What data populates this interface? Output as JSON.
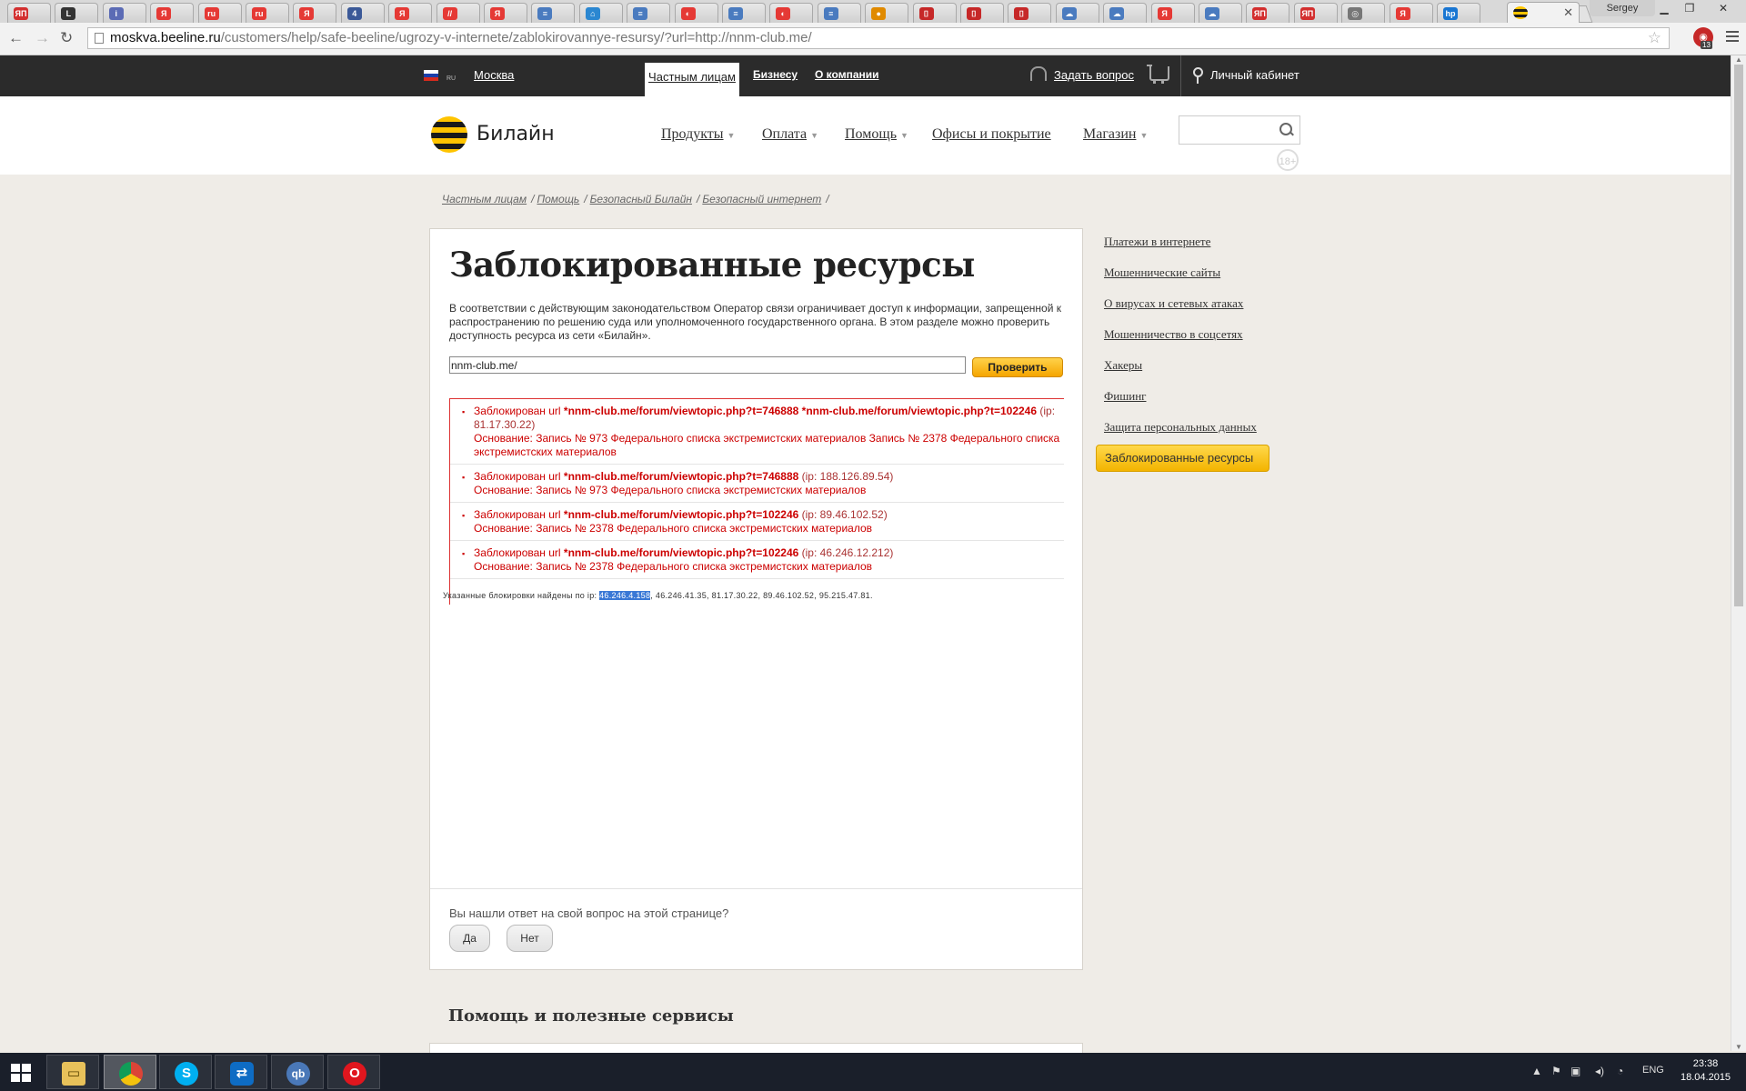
{
  "browser": {
    "tab_favicons": [
      {
        "text": "ЯП",
        "color": "#d32f2f"
      },
      {
        "text": "L",
        "color": "#333333"
      },
      {
        "text": "i",
        "color": "#5b6bb5"
      },
      {
        "text": "Я",
        "color": "#e53935"
      },
      {
        "text": "ru",
        "color": "#e53935"
      },
      {
        "text": "ru",
        "color": "#e53935"
      },
      {
        "text": "Я",
        "color": "#e53935"
      },
      {
        "text": "4",
        "color": "#3b5998"
      },
      {
        "text": "Я",
        "color": "#e53935"
      },
      {
        "text": "//",
        "color": "#e53935"
      },
      {
        "text": "Я",
        "color": "#e53935"
      },
      {
        "text": "≡",
        "color": "#4a7bbf"
      },
      {
        "text": "⌂",
        "color": "#2b87d1"
      },
      {
        "text": "≡",
        "color": "#4a7bbf"
      },
      {
        "text": "◐",
        "color": "#e53935"
      },
      {
        "text": "≡",
        "color": "#4a7bbf"
      },
      {
        "text": "◐",
        "color": "#e53935"
      },
      {
        "text": "≡",
        "color": "#4a7bbf"
      },
      {
        "text": "●",
        "color": "#e08a00"
      },
      {
        "text": "⌷",
        "color": "#c62828"
      },
      {
        "text": "⌷",
        "color": "#c62828"
      },
      {
        "text": "⌷",
        "color": "#c62828"
      },
      {
        "text": "☁",
        "color": "#4a7bbf"
      },
      {
        "text": "☁",
        "color": "#4a7bbf"
      },
      {
        "text": "Я",
        "color": "#e53935"
      },
      {
        "text": "☁",
        "color": "#4a7bbf"
      },
      {
        "text": "ЯП",
        "color": "#d32f2f"
      },
      {
        "text": "ЯП",
        "color": "#d32f2f"
      },
      {
        "text": "◎",
        "color": "#777777"
      },
      {
        "text": "Я",
        "color": "#e53935"
      },
      {
        "text": "hp",
        "color": "#1976d2"
      }
    ],
    "user_name": "Sergey",
    "url_host": "moskva.beeline.ru",
    "url_path": "/customers/help/safe-beeline/ugrozy-v-internete/zablokirovannye-resursy/?url=http://nnm-club.me/",
    "extension_badge": "13"
  },
  "topbar": {
    "city": "Москва",
    "flag_label": "RU",
    "segments": [
      "Частным лицам",
      "Бизнесу",
      "О компании"
    ],
    "ask_question": "Задать вопрос",
    "account": "Личный кабинет"
  },
  "header": {
    "logo_text": "Билайн",
    "nav": [
      "Продукты",
      "Оплата",
      "Помощь",
      "Офисы и покрытие",
      "Магазин"
    ],
    "age_badge": "18+"
  },
  "breadcrumbs": [
    "Частным лицам",
    "Помощь",
    "Безопасный Билайн",
    "Безопасный интернет"
  ],
  "main": {
    "title": "Заблокированные ресурсы",
    "intro": "В соответствии с действующим законодательством Оператор связи ограничивает доступ к информации, запрещенной к распространению по решению суда или уполномоченного государственного органа. В этом разделе можно проверить доступность ресурса из сети «Билайн».",
    "search_value": "nnm-club.me/",
    "check_button": "Проверить",
    "results": [
      {
        "prefix": "Заблокирован url ",
        "url": "*nnm-club.me/forum/viewtopic.php?t=746888 *nnm-club.me/forum/viewtopic.php?t=102246",
        "ip": " (ip: 81.17.30.22)",
        "reason": "Основание: Запись № 973 Федерального списка экстремистских материалов Запись № 2378 Федерального списка экстремистских материалов"
      },
      {
        "prefix": "Заблокирован url ",
        "url": "*nnm-club.me/forum/viewtopic.php?t=746888",
        "ip": " (ip: 188.126.89.54)",
        "reason": "Основание: Запись № 973 Федерального списка экстремистских материалов"
      },
      {
        "prefix": "Заблокирован url ",
        "url": "*nnm-club.me/forum/viewtopic.php?t=102246",
        "ip": " (ip: 89.46.102.52)",
        "reason": "Основание: Запись № 2378 Федерального списка экстремистских материалов"
      },
      {
        "prefix": "Заблокирован url ",
        "url": "*nnm-club.me/forum/viewtopic.php?t=102246",
        "ip": " (ip: 46.246.12.212)",
        "reason": "Основание: Запись № 2378 Федерального списка экстремистских материалов"
      }
    ],
    "found_prefix": "Указанные блокировки найдены по ip: ",
    "found_selected_ip": "46.246.4.158",
    "found_rest": ", 46.246.41.35, 81.17.30.22, 89.46.102.52, 95.215.47.81.",
    "feedback_question": "Вы нашли ответ на свой вопрос на этой странице?",
    "yes": "Да",
    "no": "Нет",
    "help_title": "Помощь и полезные сервисы"
  },
  "sidebar": {
    "items": [
      "Платежи в интернете",
      "Мошеннические сайты",
      "О вирусах и сетевых атаках",
      "Мошенничество в соцсетях",
      "Хакеры",
      "Фишинг",
      "Защита персональных данных"
    ],
    "active": "Заблокированные ресурсы"
  },
  "taskbar": {
    "lang": "ENG",
    "time": "23:38",
    "date": "18.04.2015"
  },
  "colors": {
    "brand_yellow": "#ffc400",
    "error_red": "#cc0000",
    "topbar": "#2b2b2b"
  }
}
